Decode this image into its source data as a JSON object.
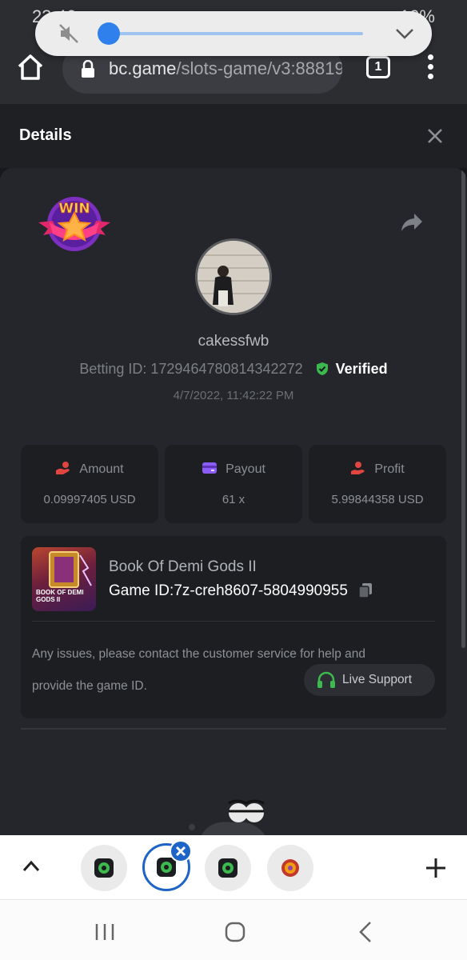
{
  "status_bar": {
    "time": "23:46",
    "battery": "10%"
  },
  "browser": {
    "url_domain": "bc.game",
    "url_path": "/slots-game/v3:88819",
    "tab_count": "1"
  },
  "volume": {
    "level_percent": 0
  },
  "header": {
    "title": "Details"
  },
  "bet": {
    "username": "cakessfwb",
    "betting_label": "Betting ID:",
    "betting_id": "1729464780814342272",
    "verified_label": "Verified",
    "timestamp": "4/7/2022, 11:42:22 PM",
    "win_badge_text": "WIN"
  },
  "stats": {
    "amount_label": "Amount",
    "amount_value": "0.09997405 USD",
    "payout_label": "Payout",
    "payout_value": "61 x",
    "profit_label": "Profit",
    "profit_value": "5.99844358 USD"
  },
  "game": {
    "name": "Book Of Demi Gods II",
    "id_label": "Game ID:",
    "id_value": "7z-creh8607-5804990955",
    "thumb_text": "BOOK OF DEMI GODS II",
    "help_line1": "Any issues, please contact the customer service for help and",
    "help_line2": "provide the game ID.",
    "support_label": "Live Support"
  },
  "colors": {
    "accent_green": "#3dba4e",
    "profit_red": "#e0463f",
    "payout_purple": "#8b5cf6",
    "tab_blue": "#1e63c7"
  }
}
